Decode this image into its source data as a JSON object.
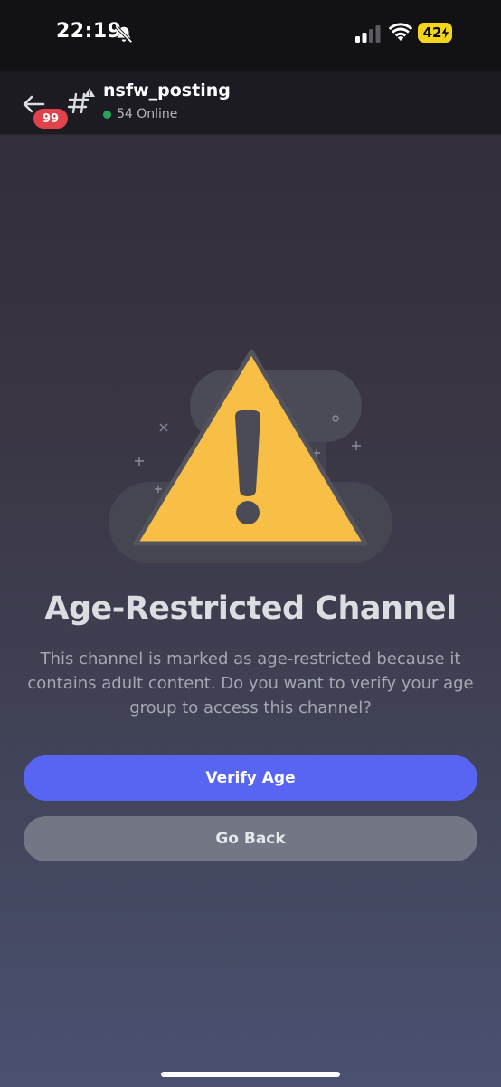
{
  "status_bar": {
    "time": "22:19",
    "battery_level": "42",
    "icons": [
      "bell-slash-icon",
      "cellular-signal-icon",
      "wifi-icon",
      "battery-charging-icon"
    ]
  },
  "header": {
    "back_icon": "arrow-left-icon",
    "unread_count": "99",
    "channel_icon": "nsfw-channel-hash-icon",
    "channel_name": "nsfw_posting",
    "online_text": "54 Online"
  },
  "main": {
    "illustration_icon": "warning-triangle-icon",
    "title": "Age-Restricted Channel",
    "description": "This channel is marked as age-restricted because it contains adult content. Do you want to verify your age group to access this channel?",
    "primary_button": "Verify Age",
    "secondary_button": "Go Back"
  },
  "colors": {
    "accent": "#5865f2",
    "warning": "#f8bf46",
    "online": "#23a55a",
    "badge": "#e0434b",
    "battery": "#f4d51a"
  }
}
